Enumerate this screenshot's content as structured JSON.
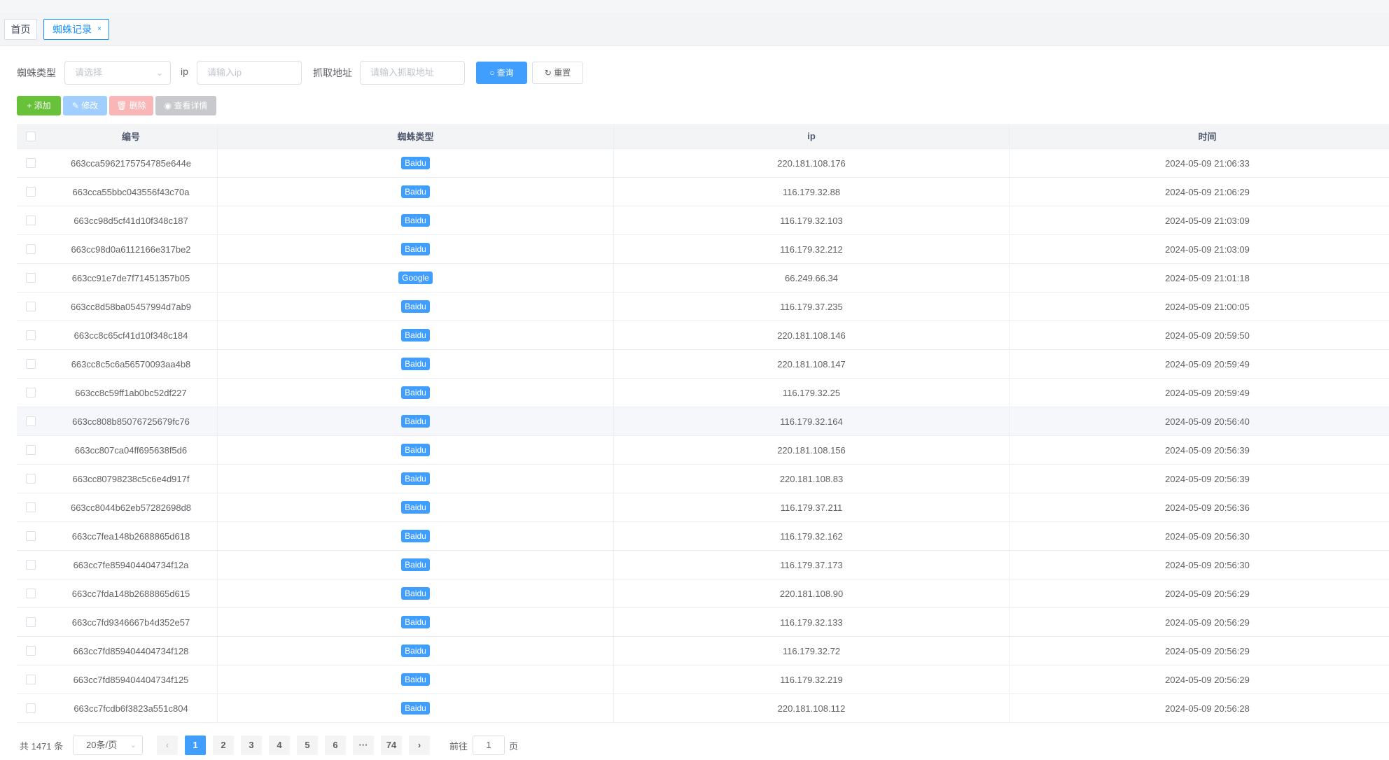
{
  "tags": {
    "home": "首页",
    "current": "蜘蛛记录",
    "close": "×"
  },
  "filters": {
    "spider_type_label": "蜘蛛类型",
    "spider_type_placeholder": "请选择",
    "ip_label": "ip",
    "ip_placeholder": "请输入ip",
    "url_label": "抓取地址",
    "url_placeholder": "请输入抓取地址",
    "search_button": "查询",
    "reset_button": "重置"
  },
  "toolbar": {
    "add": "添加",
    "edit": "修改",
    "delete": "删除",
    "view": "查看详情"
  },
  "table": {
    "columns": [
      "编号",
      "蜘蛛类型",
      "ip",
      "时间"
    ],
    "rows": [
      {
        "id": "663cca5962175754785e644e",
        "type": "Baidu",
        "ip": "220.181.108.176",
        "time": "2024-05-09 21:06:33"
      },
      {
        "id": "663cca55bbc043556f43c70a",
        "type": "Baidu",
        "ip": "116.179.32.88",
        "time": "2024-05-09 21:06:29"
      },
      {
        "id": "663cc98d5cf41d10f348c187",
        "type": "Baidu",
        "ip": "116.179.32.103",
        "time": "2024-05-09 21:03:09"
      },
      {
        "id": "663cc98d0a6112166e317be2",
        "type": "Baidu",
        "ip": "116.179.32.212",
        "time": "2024-05-09 21:03:09"
      },
      {
        "id": "663cc91e7de7f71451357b05",
        "type": "Google",
        "ip": "66.249.66.34",
        "time": "2024-05-09 21:01:18"
      },
      {
        "id": "663cc8d58ba05457994d7ab9",
        "type": "Baidu",
        "ip": "116.179.37.235",
        "time": "2024-05-09 21:00:05"
      },
      {
        "id": "663cc8c65cf41d10f348c184",
        "type": "Baidu",
        "ip": "220.181.108.146",
        "time": "2024-05-09 20:59:50"
      },
      {
        "id": "663cc8c5c6a56570093aa4b8",
        "type": "Baidu",
        "ip": "220.181.108.147",
        "time": "2024-05-09 20:59:49"
      },
      {
        "id": "663cc8c59ff1ab0bc52df227",
        "type": "Baidu",
        "ip": "116.179.32.25",
        "time": "2024-05-09 20:59:49"
      },
      {
        "id": "663cc808b85076725679fc76",
        "type": "Baidu",
        "ip": "116.179.32.164",
        "time": "2024-05-09 20:56:40"
      },
      {
        "id": "663cc807ca04ff695638f5d6",
        "type": "Baidu",
        "ip": "220.181.108.156",
        "time": "2024-05-09 20:56:39"
      },
      {
        "id": "663cc80798238c5c6e4d917f",
        "type": "Baidu",
        "ip": "220.181.108.83",
        "time": "2024-05-09 20:56:39"
      },
      {
        "id": "663cc8044b62eb57282698d8",
        "type": "Baidu",
        "ip": "116.179.37.211",
        "time": "2024-05-09 20:56:36"
      },
      {
        "id": "663cc7fea148b2688865d618",
        "type": "Baidu",
        "ip": "116.179.32.162",
        "time": "2024-05-09 20:56:30"
      },
      {
        "id": "663cc7fe859404404734f12a",
        "type": "Baidu",
        "ip": "116.179.37.173",
        "time": "2024-05-09 20:56:30"
      },
      {
        "id": "663cc7fda148b2688865d615",
        "type": "Baidu",
        "ip": "220.181.108.90",
        "time": "2024-05-09 20:56:29"
      },
      {
        "id": "663cc7fd9346667b4d352e57",
        "type": "Baidu",
        "ip": "116.179.32.133",
        "time": "2024-05-09 20:56:29"
      },
      {
        "id": "663cc7fd859404404734f128",
        "type": "Baidu",
        "ip": "116.179.32.72",
        "time": "2024-05-09 20:56:29"
      },
      {
        "id": "663cc7fd859404404734f125",
        "type": "Baidu",
        "ip": "116.179.32.219",
        "time": "2024-05-09 20:56:29"
      },
      {
        "id": "663cc7fcdb6f3823a551c804",
        "type": "Baidu",
        "ip": "220.181.108.112",
        "time": "2024-05-09 20:56:28"
      }
    ]
  },
  "pagination": {
    "total": "共 1471 条",
    "page_size": "20条/页",
    "pages": [
      "1",
      "2",
      "3",
      "4",
      "5",
      "6",
      "···",
      "74"
    ],
    "current": "1",
    "prev": "‹",
    "next": "›",
    "goto_label": "前往",
    "goto_value": "1",
    "goto_suffix": "页"
  },
  "colors": {
    "primary": "#409eff",
    "success": "#67c23a",
    "danger_light": "#fab6b6",
    "primary_light": "#a0cfff",
    "info_light": "#c8c9cc"
  }
}
